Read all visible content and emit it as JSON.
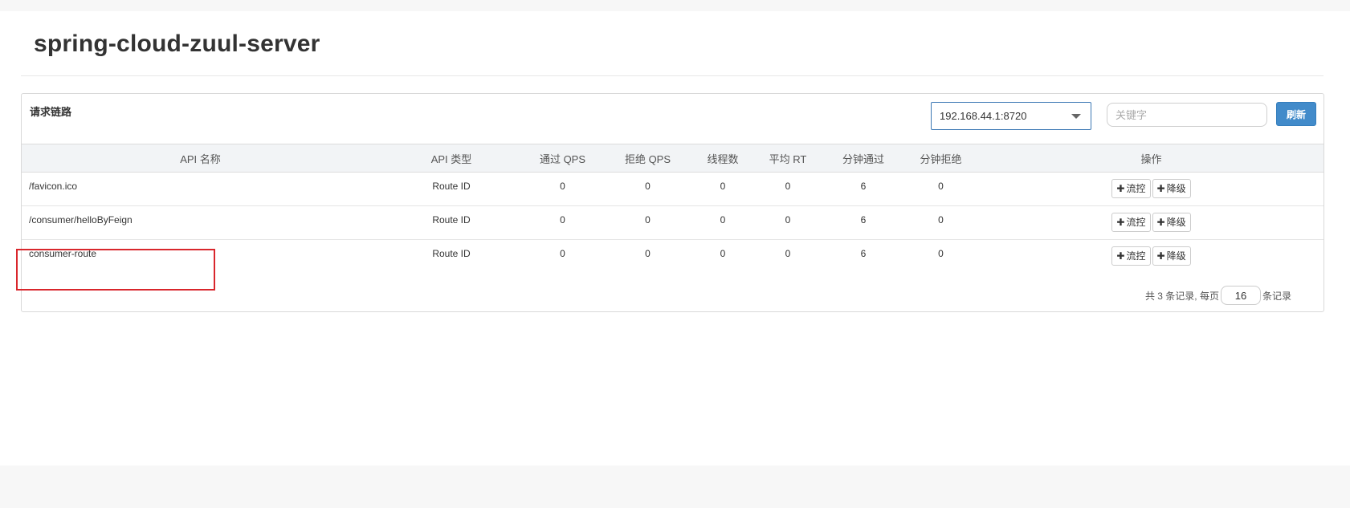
{
  "app": {
    "title": "spring-cloud-zuul-server"
  },
  "panel": {
    "heading": "请求链路",
    "machine_select": {
      "selected": "192.168.44.1:8720"
    },
    "search": {
      "placeholder": "关键字",
      "value": ""
    },
    "refresh_label": "刷新"
  },
  "table": {
    "columns": [
      "API 名称",
      "API 类型",
      "通过 QPS",
      "拒绝 QPS",
      "线程数",
      "平均 RT",
      "分钟通过",
      "分钟拒绝",
      "操作"
    ],
    "rows": [
      {
        "name": "/favicon.ico",
        "type": "Route ID",
        "pass_qps": "0",
        "block_qps": "0",
        "threads": "0",
        "avg_rt": "0",
        "minute_pass": "6",
        "minute_block": "0"
      },
      {
        "name": "/consumer/helloByFeign",
        "type": "Route ID",
        "pass_qps": "0",
        "block_qps": "0",
        "threads": "0",
        "avg_rt": "0",
        "minute_pass": "6",
        "minute_block": "0"
      },
      {
        "name": "consumer-route",
        "type": "Route ID",
        "pass_qps": "0",
        "block_qps": "0",
        "threads": "0",
        "avg_rt": "0",
        "minute_pass": "6",
        "minute_block": "0"
      }
    ],
    "actions": {
      "flow_label": "流控",
      "degrade_label": "降级"
    }
  },
  "pager": {
    "prefix": "共 3 条记录, 每页",
    "page_size": "16",
    "suffix": "条记录"
  },
  "colors": {
    "primary": "#428bca",
    "highlight": "#d9262c",
    "select_border": "#3c78b4"
  }
}
